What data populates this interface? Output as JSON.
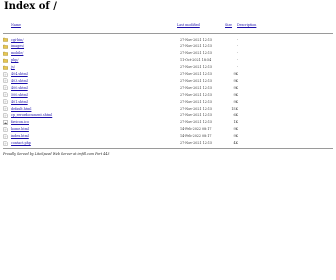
{
  "page": {
    "title": "Index of /"
  },
  "columns": {
    "name": "Name",
    "last_modified": "Last modified",
    "size": "Size",
    "description": "Description"
  },
  "entries": [
    {
      "type": "folder",
      "name": "cgi-bin/",
      "date": "27-Nov-2021 12:15",
      "size": "-"
    },
    {
      "type": "folder",
      "name": "images/",
      "date": "27-Nov-2021 12:15",
      "size": "-"
    },
    {
      "type": "folder",
      "name": "mobile/",
      "date": "27-Nov-2021 12:15",
      "size": "-"
    },
    {
      "type": "folder",
      "name": "php/",
      "date": "11-Oct-2021 18:54",
      "size": "-"
    },
    {
      "type": "folder",
      "name": "js/",
      "date": "27-Nov-2021 12:15",
      "size": "-"
    },
    {
      "type": "file",
      "name": "404.shtml",
      "date": "27-Nov-2021 12:15",
      "size": "9K"
    },
    {
      "type": "file",
      "name": "403.shtml",
      "date": "27-Nov-2021 12:15",
      "size": "9K"
    },
    {
      "type": "file",
      "name": "400.shtml",
      "date": "27-Nov-2021 12:15",
      "size": "9K"
    },
    {
      "type": "file",
      "name": "500.shtml",
      "date": "27-Nov-2021 12:15",
      "size": "9K"
    },
    {
      "type": "file",
      "name": "401.shtml",
      "date": "27-Nov-2021 12:15",
      "size": "9K"
    },
    {
      "type": "file",
      "name": "default.html",
      "date": "27-Nov-2021 12:15",
      "size": "15K"
    },
    {
      "type": "file",
      "name": "cp_errordocument.shtml",
      "date": "27-Nov-2021 12:15",
      "size": "6K"
    },
    {
      "type": "image",
      "name": "favicon.ico",
      "date": "27-Nov-2021 12:15",
      "size": "1K"
    },
    {
      "type": "file",
      "name": "home.html",
      "date": "14-Feb-2022 08:17",
      "size": "9K"
    },
    {
      "type": "file",
      "name": "index.html",
      "date": "14-Feb-2022 08:17",
      "size": "9K"
    },
    {
      "type": "file",
      "name": "contact.php",
      "date": "27-Nov-2021 12:15",
      "size": "4K"
    }
  ],
  "footer": "Proudly Served by LiteSpeed Web Server at imfdl.com Port 443",
  "colors": {
    "link": "#1a0dab",
    "folder_fill": "#e6c652",
    "file_fill": "#ffffff",
    "rule": "#9a9a9a"
  }
}
